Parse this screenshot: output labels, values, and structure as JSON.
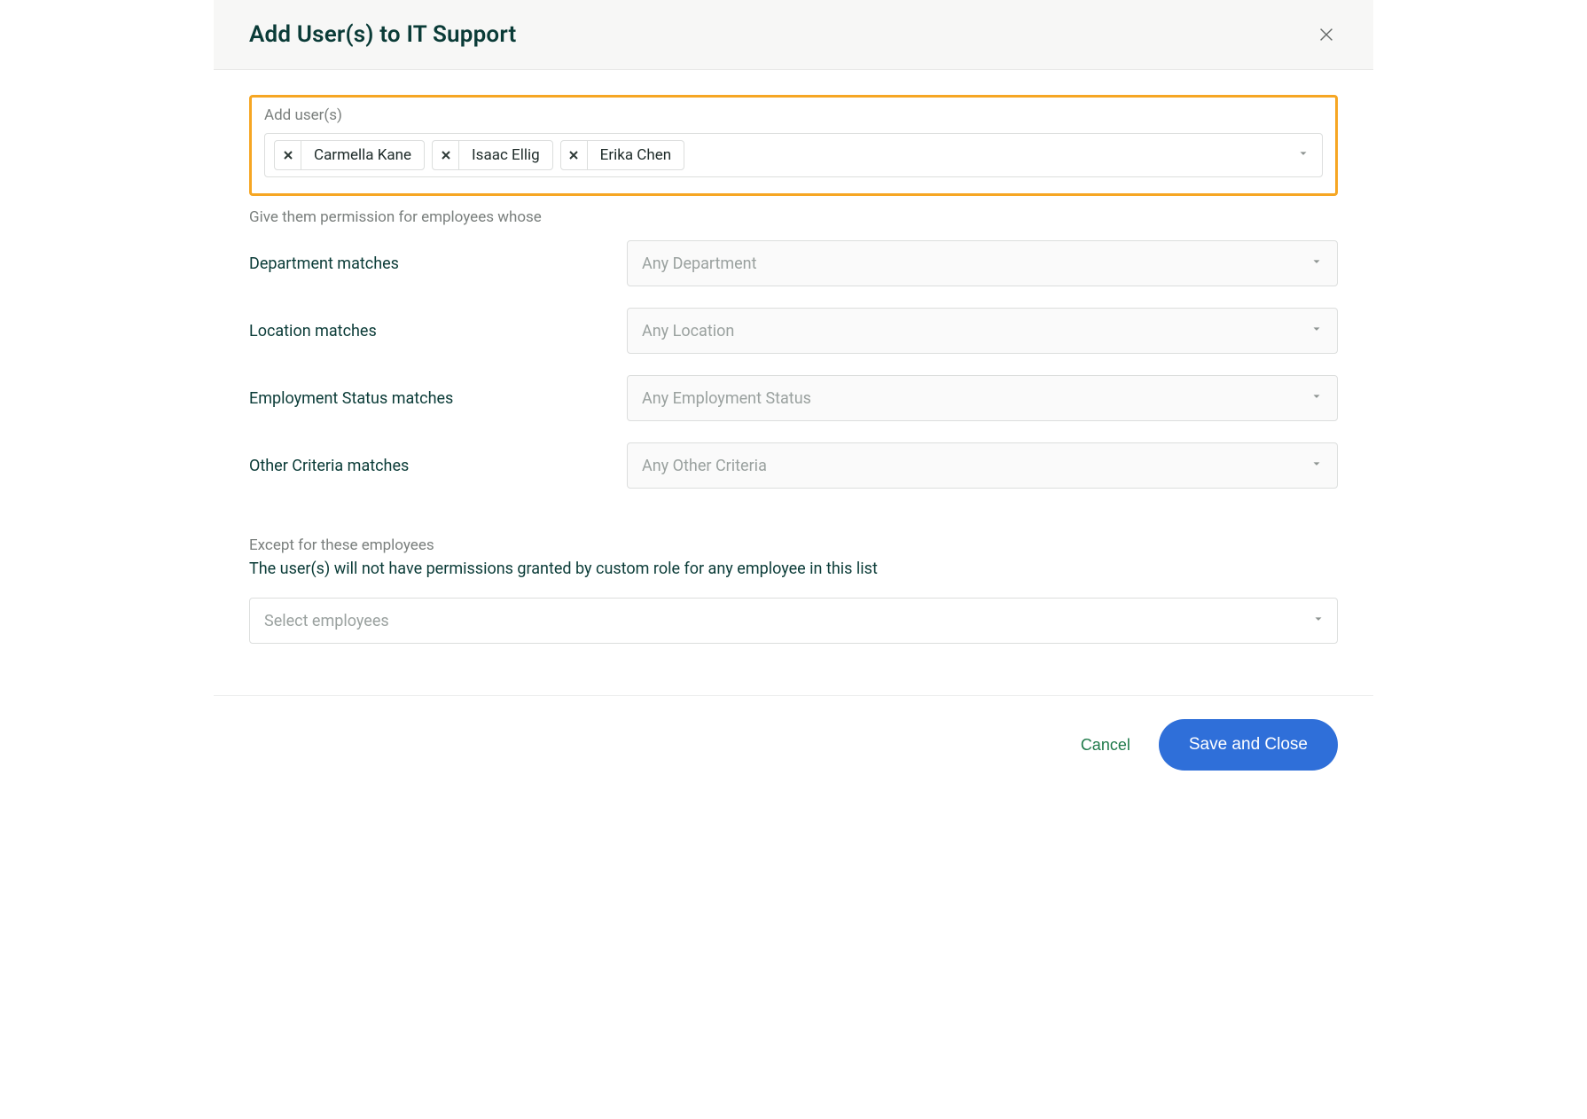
{
  "header": {
    "title": "Add User(s) to IT Support"
  },
  "add_users": {
    "label": "Add user(s)",
    "chips": [
      "Carmella Kane",
      "Isaac Ellig",
      "Erika Chen"
    ]
  },
  "permission_intro": "Give them permission for employees whose",
  "criteria": [
    {
      "label": "Department matches",
      "placeholder": "Any Department"
    },
    {
      "label": "Location matches",
      "placeholder": "Any Location"
    },
    {
      "label": "Employment Status matches",
      "placeholder": "Any Employment Status"
    },
    {
      "label": "Other Criteria matches",
      "placeholder": "Any Other Criteria"
    }
  ],
  "except": {
    "label": "Except for these employees",
    "description": "The user(s) will not have permissions granted by custom role for any employee in this list",
    "placeholder": "Select employees"
  },
  "footer": {
    "cancel": "Cancel",
    "save": "Save and Close"
  }
}
